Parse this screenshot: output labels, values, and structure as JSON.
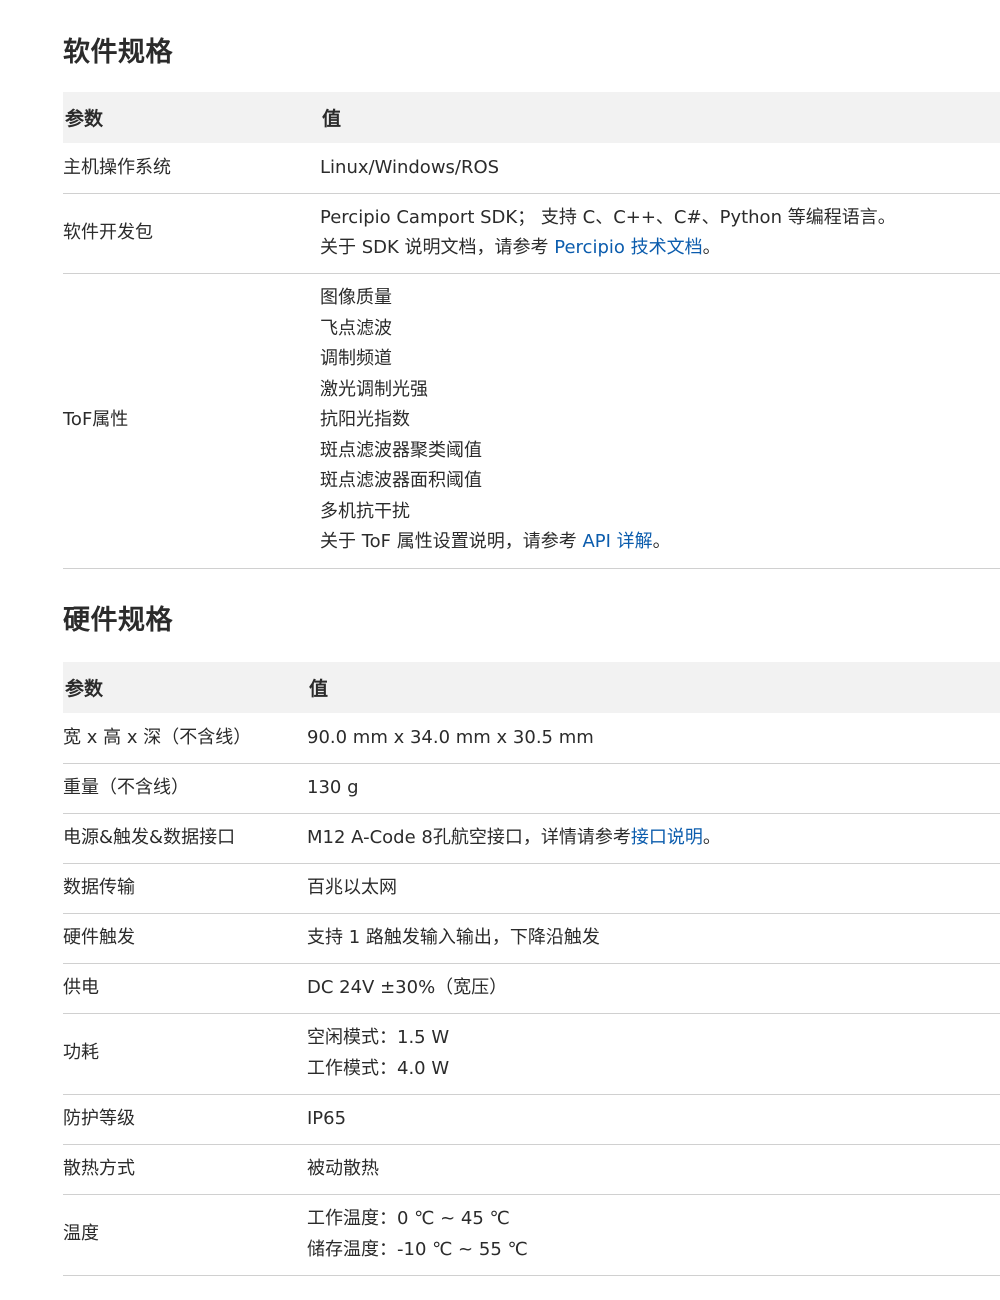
{
  "software": {
    "title": "软件规格",
    "header": {
      "param": "参数",
      "value": "值"
    },
    "rows": {
      "os": {
        "param": "主机操作系统",
        "value": "Linux/Windows/ROS"
      },
      "sdk": {
        "param": "软件开发包",
        "line1": "Percipio Camport SDK； 支持 C、C++、C#、Python 等编程语言。",
        "line2_prefix": "关于 SDK 说明文档，请参考 ",
        "line2_link": "Percipio 技术文档",
        "line2_suffix": "。"
      },
      "tof": {
        "param": "ToF属性",
        "items": [
          "图像质量",
          "飞点滤波",
          "调制频道",
          "激光调制光强",
          "抗阳光指数",
          "斑点滤波器聚类阈值",
          "斑点滤波器面积阈值",
          "多机抗干扰"
        ],
        "note_prefix": "关于 ToF 属性设置说明，请参考 ",
        "note_link": "API 详解",
        "note_suffix": "。"
      }
    }
  },
  "hardware": {
    "title": "硬件规格",
    "header": {
      "param": "参数",
      "value": "值"
    },
    "rows": {
      "size": {
        "param": "宽 x 高 x 深（不含线）",
        "value": "90.0 mm x 34.0 mm x 30.5 mm"
      },
      "weight": {
        "param": "重量（不含线）",
        "value": "130 g"
      },
      "port": {
        "param": "电源&触发&数据接口",
        "value_prefix": "M12 A-Code 8孔航空接口，详情请参考",
        "value_link": "接口说明",
        "value_suffix": "。"
      },
      "transfer": {
        "param": "数据传输",
        "value": "百兆以太网"
      },
      "trigger": {
        "param": "硬件触发",
        "value": "支持 1 路触发输入输出，下降沿触发"
      },
      "power": {
        "param": "供电",
        "value": "DC 24V ±30%（宽压）"
      },
      "consumption": {
        "param": "功耗",
        "line1": "空闲模式：1.5 W",
        "line2": "工作模式：4.0 W"
      },
      "protection": {
        "param": "防护等级",
        "value": "IP65"
      },
      "cooling": {
        "param": "散热方式",
        "value": "被动散热"
      },
      "temperature": {
        "param": "温度",
        "line1": "工作温度：0 ℃ ~ 45 ℃",
        "line2": "储存温度：-10 ℃ ~ 55 ℃"
      }
    }
  },
  "colors": {
    "link": "#0b5cad",
    "header_bg": "#f2f2f2",
    "text": "#2b2b2b",
    "rule": "#d0d0d0"
  }
}
